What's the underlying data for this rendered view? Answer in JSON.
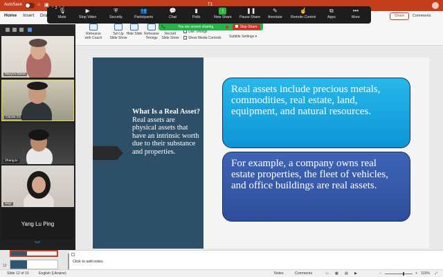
{
  "titlebar": {
    "autosave_label": "AutoSave",
    "toggle_state": "OFF",
    "doc_title": "T1"
  },
  "tabs": [
    "Home",
    "Insert",
    "Draw"
  ],
  "ribbon_right": {
    "share_label": "Share",
    "comments_label": "Comments"
  },
  "ribbon": {
    "buttons": [
      {
        "label": "Rehearse with Coach"
      },
      {
        "label": "Set Up Slide Show"
      },
      {
        "label": "Hide Slide"
      },
      {
        "label": "Rehearse Timings"
      },
      {
        "label": "Record Slide Show"
      }
    ],
    "checkboxes": [
      "Use Timings",
      "Show Media Controls"
    ],
    "subtitle_settings": "Subtitle Settings"
  },
  "zoom_toolbar": {
    "items": [
      {
        "label": "Mute",
        "icon": "microphone-icon"
      },
      {
        "label": "Stop Video",
        "icon": "video-camera-icon"
      },
      {
        "label": "Security",
        "icon": "shield-icon"
      },
      {
        "label": "Participants",
        "icon": "participants-icon",
        "count": "2"
      },
      {
        "label": "Chat",
        "icon": "chat-icon"
      },
      {
        "label": "Polls",
        "icon": "polls-icon"
      },
      {
        "label": "New Share",
        "icon": "share-screen-icon"
      },
      {
        "label": "Pause Share",
        "icon": "pause-icon"
      },
      {
        "label": "Annotate",
        "icon": "pencil-icon"
      },
      {
        "label": "Remote Control",
        "icon": "remote-control-icon"
      },
      {
        "label": "Apps",
        "icon": "apps-icon"
      },
      {
        "label": "More",
        "icon": "more-icon"
      }
    ],
    "banner": "You are screen sharing",
    "stop_share": "Stop Share"
  },
  "participants": [
    {
      "name": "Maryna Dielini"
    },
    {
      "name": "Своэм Cs"
    },
    {
      "name": "ZhangJu"
    },
    {
      "name": "wuyi"
    },
    {
      "name": "Yang Lu Ping"
    }
  ],
  "thumbnails": {
    "selected_number": "12",
    "next_number": "13"
  },
  "slide": {
    "left_heading": "What Is a Real Asset?",
    "left_body": "Real assets are physical assets that have an intrinsic worth due to their substance and properties.",
    "box1": "Real assets include precious metals, commodities, real estate, land, equipment, and natural resources.",
    "box2": "For example, a company owns real estate properties, the fleet of vehicles, and office buildings are real assets.",
    "colors": {
      "left_panel": "#2e4f68",
      "box1": "#1aa8e2",
      "box2": "#345aa8"
    }
  },
  "notes": {
    "placeholder": "Click to add notes"
  },
  "status": {
    "slide_info": "Slide 12 of 15",
    "language": "English (Ukraine)",
    "notes": "Notes",
    "comments": "Comments",
    "zoom": "115%"
  }
}
